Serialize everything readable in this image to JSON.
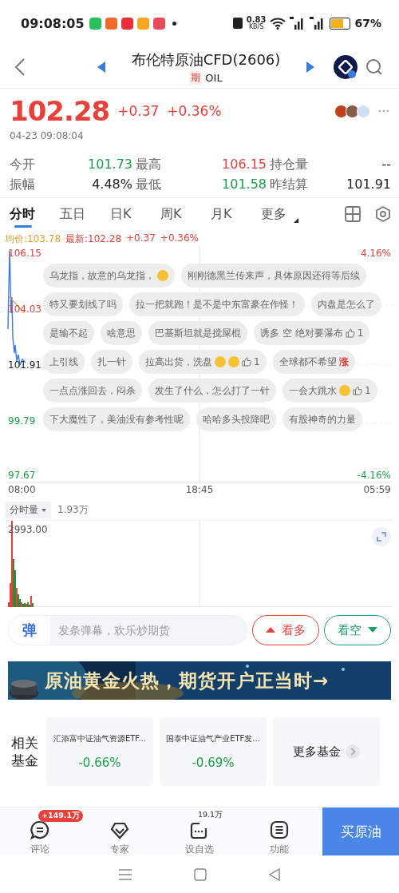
{
  "status_bar": {
    "time": "09:08:05",
    "speed": "0.83",
    "speed_unit": "KB/S",
    "battery": "67%"
  },
  "header": {
    "title": "布伦特原油CFD(2606)",
    "tag": "期",
    "code": "OIL"
  },
  "quote": {
    "price": "102.28",
    "change": "+0.37",
    "change_pct": "+0.36%",
    "time": "04-23 09:08:04"
  },
  "stats": [
    {
      "label": "今开",
      "value": "101.73",
      "color": "#1a9e4a"
    },
    {
      "label": "最高",
      "value": "106.15",
      "color": "#e8403a"
    },
    {
      "label": "持仓量",
      "value": "--",
      "color": "#222222"
    },
    {
      "label": "振幅",
      "value": "4.48%",
      "color": "#222222"
    },
    {
      "label": "最低",
      "value": "101.58",
      "color": "#1a9e4a"
    },
    {
      "label": "昨结算",
      "value": "101.91",
      "color": "#222222"
    }
  ],
  "chart_tabs": [
    {
      "label": "分时",
      "selected": true,
      "dropdown": false
    },
    {
      "label": "五日",
      "selected": false,
      "dropdown": false
    },
    {
      "label": "日K",
      "selected": false,
      "dropdown": false
    },
    {
      "label": "周K",
      "selected": false,
      "dropdown": false
    },
    {
      "label": "月K",
      "selected": false,
      "dropdown": false
    },
    {
      "label": "更多",
      "selected": false,
      "dropdown": true
    }
  ],
  "chart_summary": {
    "avg": "均价:103.78",
    "latest": "最新:102.28",
    "change": "+0.37",
    "change_pct": "+0.36%"
  },
  "price_chart": {
    "left_labels": [
      {
        "text": "106.15",
        "color": "#e8403a"
      },
      {
        "text": "104.03",
        "color": "#e8403a"
      },
      {
        "text": "101.91",
        "color": "#222222"
      },
      {
        "text": "99.79",
        "color": "#1a9e4a"
      },
      {
        "text": "97.67",
        "color": "#1a9e4a"
      }
    ],
    "right_labels": [
      {
        "text": "4.16%",
        "color": "#e8403a"
      },
      {
        "text": "-4.16%",
        "color": "#1a9e4a"
      }
    ],
    "time_labels": [
      "08:00",
      "18:45",
      "05:59"
    ]
  },
  "danmaku": [
    [
      {
        "text": "乌龙指，故意的乌龙指，",
        "emoji": true
      },
      {
        "text": "刚刚德黑兰传来声，具体原因还得等后续"
      }
    ],
    [
      {
        "text": "特又要划线了吗"
      },
      {
        "text": "拉一把就跑！是不是中东富豪在作怪！"
      },
      {
        "text": "内盘是怎么了"
      }
    ],
    [
      {
        "text": "是输不起"
      },
      {
        "text": "啥意思"
      },
      {
        "text": "巴基斯坦就是搅屎棍"
      },
      {
        "text": "诱多 空 绝对要瀑布",
        "likes": "1"
      }
    ],
    [
      {
        "text": "上引线"
      },
      {
        "text": "扎一针"
      },
      {
        "text": "拉高出货，洗盘",
        "emoji": true,
        "emoji_twice": true,
        "likes": "1"
      },
      {
        "text": "全球都不希望",
        "highlight": "涨"
      }
    ],
    [
      {
        "text": "一点点涨回去，闷杀"
      },
      {
        "text": "发生了什么，怎么打了一针"
      },
      {
        "text": "一会大跳水",
        "emoji": true,
        "likes": "1"
      }
    ],
    [
      {
        "text": "下大魔性了，美油没有参考性呢"
      },
      {
        "text": "哈哈多头投降吧"
      },
      {
        "text": "有股神奇的力量"
      }
    ]
  ],
  "volume": {
    "selector": "分时量",
    "total": "1.93万",
    "max_label": "2993.00"
  },
  "comment_bar": {
    "icon_text": "弹",
    "placeholder": "发条弹幕，欢乐炒期货",
    "bull": "看多",
    "bear": "看空"
  },
  "banner": {
    "text": "原油黄金火热，期货开户正当时→"
  },
  "funds": {
    "label": "相关基金",
    "items": [
      {
        "name": "汇添富中证油气资源ETF...",
        "change": "-0.66%",
        "color": "#1a9e4a"
      },
      {
        "name": "国泰中证油气产业ETF发...",
        "change": "-0.69%",
        "color": "#1a9e4a"
      }
    ],
    "more": "更多基金"
  },
  "bottom_nav": [
    {
      "label": "评论",
      "badge": "+149.1万",
      "kind": "pill"
    },
    {
      "label": "专家"
    },
    {
      "label": "设自选",
      "badge": "19.1万",
      "kind": "plain"
    },
    {
      "label": "功能"
    }
  ],
  "buy_button": "买原油"
}
